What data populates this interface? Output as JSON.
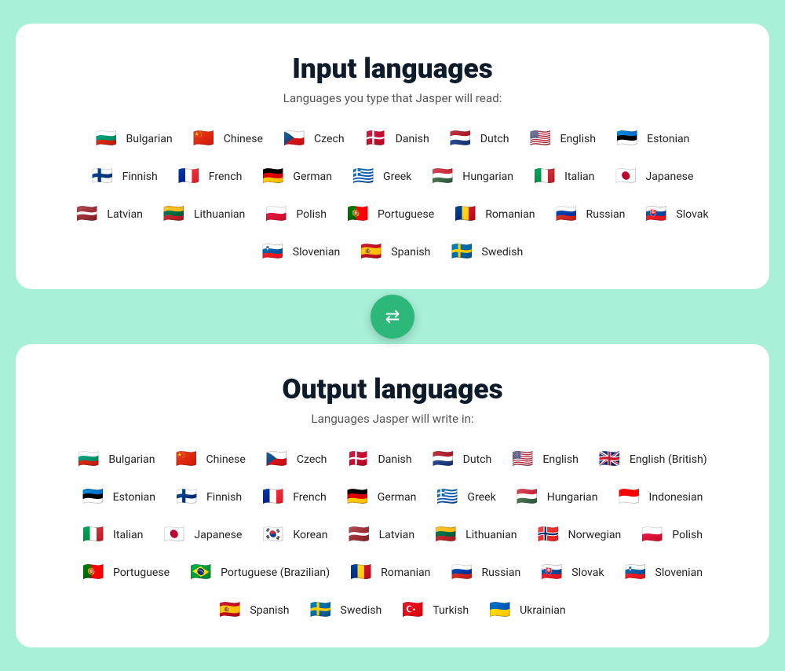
{
  "input_section": {
    "title": "Input languages",
    "subtitle": "Languages you type that Jasper will read:",
    "languages": [
      {
        "name": "Bulgarian",
        "flag": "🇧🇬"
      },
      {
        "name": "Chinese",
        "flag": "🇨🇳"
      },
      {
        "name": "Czech",
        "flag": "🇨🇿"
      },
      {
        "name": "Danish",
        "flag": "🇩🇰"
      },
      {
        "name": "Dutch",
        "flag": "🇳🇱"
      },
      {
        "name": "English",
        "flag": "🇺🇸"
      },
      {
        "name": "Estonian",
        "flag": "🇪🇪"
      },
      {
        "name": "Finnish",
        "flag": "🇫🇮"
      },
      {
        "name": "French",
        "flag": "🇫🇷"
      },
      {
        "name": "German",
        "flag": "🇩🇪"
      },
      {
        "name": "Greek",
        "flag": "🇬🇷"
      },
      {
        "name": "Hungarian",
        "flag": "🇭🇺"
      },
      {
        "name": "Italian",
        "flag": "🇮🇹"
      },
      {
        "name": "Japanese",
        "flag": "🇯🇵"
      },
      {
        "name": "Latvian",
        "flag": "🇱🇻"
      },
      {
        "name": "Lithuanian",
        "flag": "🇱🇹"
      },
      {
        "name": "Polish",
        "flag": "🇵🇱"
      },
      {
        "name": "Portuguese",
        "flag": "🇵🇹"
      },
      {
        "name": "Romanian",
        "flag": "🇷🇴"
      },
      {
        "name": "Russian",
        "flag": "🇷🇺"
      },
      {
        "name": "Slovak",
        "flag": "🇸🇰"
      },
      {
        "name": "Slovenian",
        "flag": "🇸🇮"
      },
      {
        "name": "Spanish",
        "flag": "🇪🇸"
      },
      {
        "name": "Swedish",
        "flag": "🇸🇪"
      }
    ]
  },
  "swap_button_label": "⇄",
  "output_section": {
    "title": "Output languages",
    "subtitle": "Languages Jasper will write in:",
    "languages": [
      {
        "name": "Bulgarian",
        "flag": "🇧🇬"
      },
      {
        "name": "Chinese",
        "flag": "🇨🇳"
      },
      {
        "name": "Czech",
        "flag": "🇨🇿"
      },
      {
        "name": "Danish",
        "flag": "🇩🇰"
      },
      {
        "name": "Dutch",
        "flag": "🇳🇱"
      },
      {
        "name": "English",
        "flag": "🇺🇸"
      },
      {
        "name": "English (British)",
        "flag": "🇬🇧"
      },
      {
        "name": "Estonian",
        "flag": "🇪🇪"
      },
      {
        "name": "Finnish",
        "flag": "🇫🇮"
      },
      {
        "name": "French",
        "flag": "🇫🇷"
      },
      {
        "name": "German",
        "flag": "🇩🇪"
      },
      {
        "name": "Greek",
        "flag": "🇬🇷"
      },
      {
        "name": "Hungarian",
        "flag": "🇭🇺"
      },
      {
        "name": "Indonesian",
        "flag": "🇮🇩"
      },
      {
        "name": "Italian",
        "flag": "🇮🇹"
      },
      {
        "name": "Japanese",
        "flag": "🇯🇵"
      },
      {
        "name": "Korean",
        "flag": "🇰🇷"
      },
      {
        "name": "Latvian",
        "flag": "🇱🇻"
      },
      {
        "name": "Lithuanian",
        "flag": "🇱🇹"
      },
      {
        "name": "Norwegian",
        "flag": "🇳🇴"
      },
      {
        "name": "Polish",
        "flag": "🇵🇱"
      },
      {
        "name": "Portuguese",
        "flag": "🇵🇹"
      },
      {
        "name": "Portuguese (Brazilian)",
        "flag": "🇧🇷"
      },
      {
        "name": "Romanian",
        "flag": "🇷🇴"
      },
      {
        "name": "Russian",
        "flag": "🇷🇺"
      },
      {
        "name": "Slovak",
        "flag": "🇸🇰"
      },
      {
        "name": "Slovenian",
        "flag": "🇸🇮"
      },
      {
        "name": "Spanish",
        "flag": "🇪🇸"
      },
      {
        "name": "Swedish",
        "flag": "🇸🇪"
      },
      {
        "name": "Turkish",
        "flag": "🇹🇷"
      },
      {
        "name": "Ukrainian",
        "flag": "🇺🇦"
      }
    ]
  }
}
